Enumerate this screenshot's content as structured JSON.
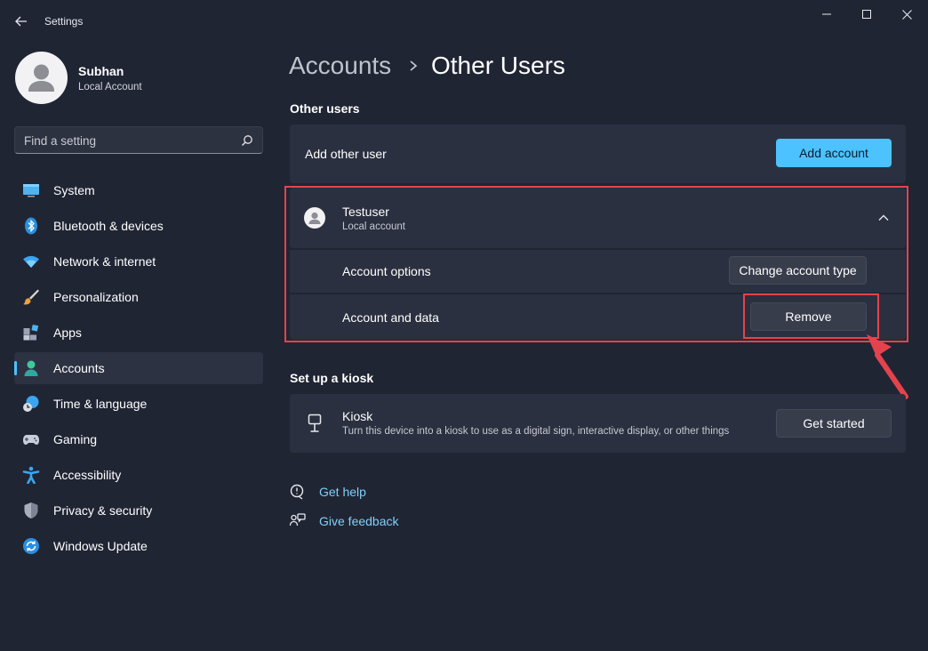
{
  "window": {
    "title": "Settings",
    "controls": [
      "minimize",
      "maximize",
      "close"
    ]
  },
  "profile": {
    "name": "Subhan",
    "account_type": "Local Account"
  },
  "search": {
    "placeholder": "Find a setting"
  },
  "sidebar": {
    "items": [
      {
        "label": "System",
        "icon": "system-icon",
        "active": false
      },
      {
        "label": "Bluetooth & devices",
        "icon": "bluetooth-icon",
        "active": false
      },
      {
        "label": "Network & internet",
        "icon": "wifi-icon",
        "active": false
      },
      {
        "label": "Personalization",
        "icon": "brush-icon",
        "active": false
      },
      {
        "label": "Apps",
        "icon": "apps-icon",
        "active": false
      },
      {
        "label": "Accounts",
        "icon": "accounts-icon",
        "active": true
      },
      {
        "label": "Time & language",
        "icon": "time-language-icon",
        "active": false
      },
      {
        "label": "Gaming",
        "icon": "gamepad-icon",
        "active": false
      },
      {
        "label": "Accessibility",
        "icon": "accessibility-icon",
        "active": false
      },
      {
        "label": "Privacy & security",
        "icon": "shield-icon",
        "active": false
      },
      {
        "label": "Windows Update",
        "icon": "update-icon",
        "active": false
      }
    ]
  },
  "breadcrumb": {
    "parent": "Accounts",
    "current": "Other Users"
  },
  "other_users": {
    "heading": "Other users",
    "add_label": "Add other user",
    "add_button": "Add account",
    "user": {
      "name": "Testuser",
      "type": "Local account",
      "expanded": true,
      "account_options_label": "Account options",
      "change_type_button": "Change account type",
      "account_data_label": "Account and data",
      "remove_button": "Remove"
    }
  },
  "kiosk": {
    "heading": "Set up a kiosk",
    "title": "Kiosk",
    "description": "Turn this device into a kiosk to use as a digital sign, interactive display, or other things",
    "button": "Get started"
  },
  "links": {
    "help": "Get help",
    "feedback": "Give feedback"
  },
  "colors": {
    "background": "#202534",
    "card": "#2b3040",
    "accent": "#4cc2ff",
    "highlight": "#e5434c"
  }
}
